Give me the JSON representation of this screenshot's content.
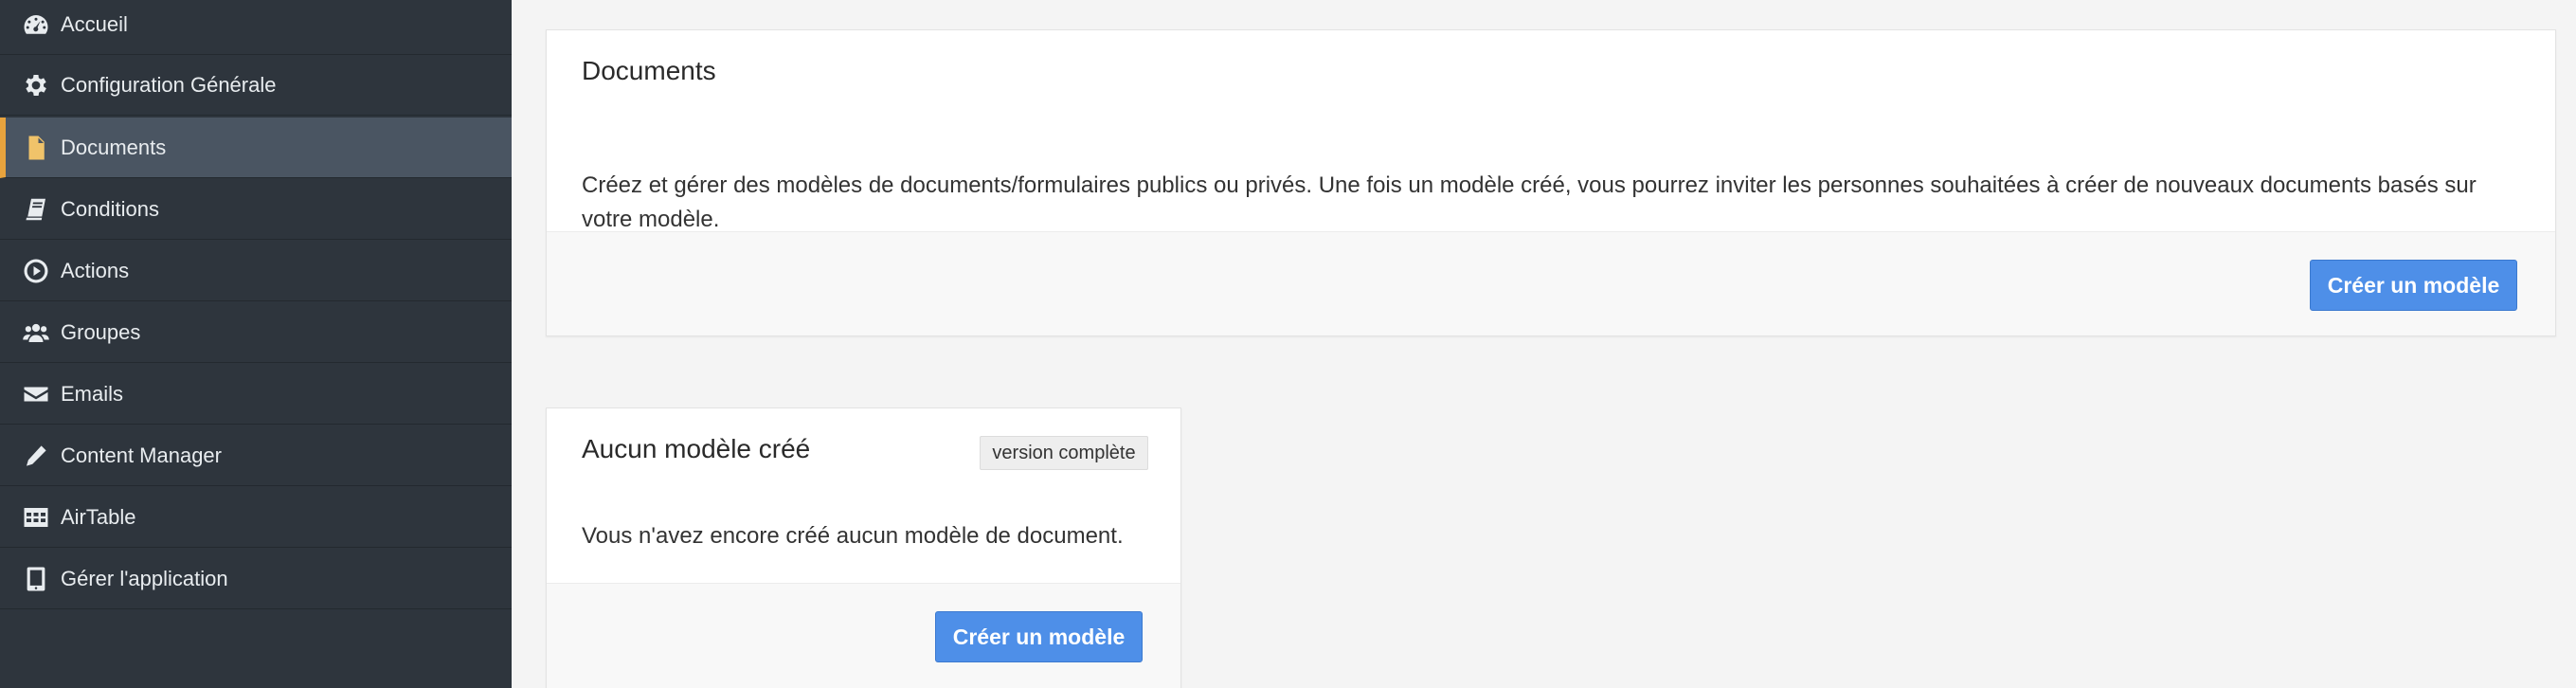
{
  "sidebar": {
    "items": [
      {
        "label": "Accueil",
        "icon": "dashboard-icon"
      },
      {
        "label": "Configuration Générale",
        "icon": "gear-icon"
      },
      {
        "label": "Documents",
        "icon": "document-icon",
        "active": true
      },
      {
        "label": "Conditions",
        "icon": "book-icon"
      },
      {
        "label": "Actions",
        "icon": "play-circle-icon"
      },
      {
        "label": "Groupes",
        "icon": "users-icon"
      },
      {
        "label": "Emails",
        "icon": "envelope-icon"
      },
      {
        "label": "Content Manager",
        "icon": "pencil-icon"
      },
      {
        "label": "AirTable",
        "icon": "table-icon"
      },
      {
        "label": "Gérer l'application",
        "icon": "tablet-icon"
      }
    ],
    "accent_color": "#e8a33d"
  },
  "documents_card": {
    "title": "Documents",
    "description": "Créez et gérer des modèles de documents/formulaires publics ou privés. Une fois un modèle créé, vous pourrez inviter les personnes souhaitées à créer de nouveaux documents basés sur votre modèle.",
    "create_button": "Créer un modèle"
  },
  "empty_card": {
    "title": "Aucun modèle créé",
    "badge": "version complète",
    "message": "Vous n'avez encore créé aucun modèle de document.",
    "create_button": "Créer un modèle"
  },
  "colors": {
    "primary_button": "#4e8fe8",
    "sidebar_bg": "#2e353d",
    "sidebar_active_bg": "#4a5562"
  }
}
